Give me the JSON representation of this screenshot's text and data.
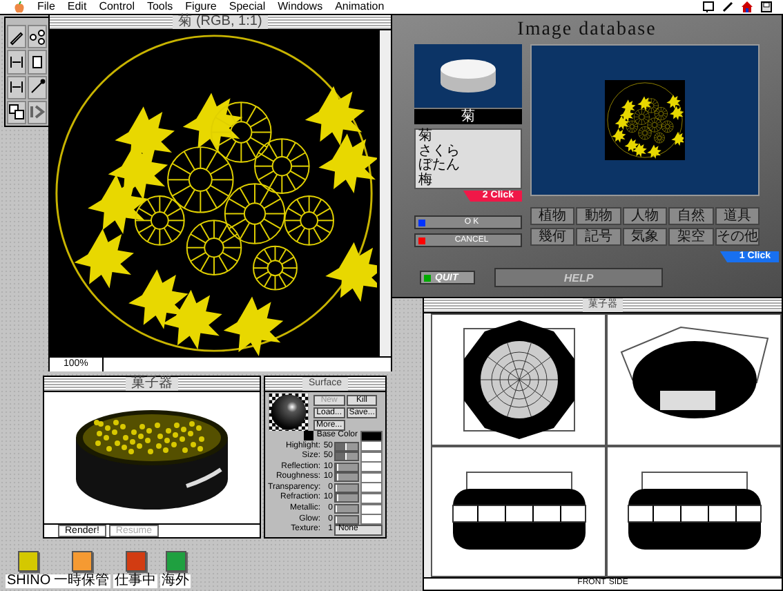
{
  "menu_bar": {
    "items": [
      "File",
      "Edit",
      "Control",
      "Tools",
      "Figure",
      "Special",
      "Windows",
      "Animation"
    ]
  },
  "image_window": {
    "title": "菊 (RGB, 1:1)",
    "zoom": "100%"
  },
  "image_database": {
    "title": "Image database",
    "caption": "菊",
    "list": [
      {
        "label": "菊",
        "selected": false
      },
      {
        "label": "さくら",
        "selected": false
      },
      {
        "label": "ぼたん",
        "selected": false
      },
      {
        "label": "梅",
        "selected": false
      }
    ],
    "list_hint": "2 Click",
    "ok": "O K",
    "cancel": "CANCEL",
    "categories": [
      "植物",
      "動物",
      "人物",
      "自然",
      "道具",
      "幾何",
      "記号",
      "気象",
      "架空",
      "その他"
    ],
    "grid_hint": "1 Click",
    "quit": "QUIT",
    "help": "HELP"
  },
  "render_window": {
    "title": "菓子器",
    "buttons": [
      {
        "label": "Render!",
        "disabled": false
      },
      {
        "label": "Resume",
        "disabled": true
      }
    ]
  },
  "surface_panel": {
    "title": "Surface",
    "buttons": [
      {
        "label": "New",
        "disabled": true
      },
      {
        "label": "Kill",
        "disabled": false
      },
      {
        "label": "Load...",
        "disabled": false
      },
      {
        "label": "Save...",
        "disabled": false
      },
      {
        "label": "More...",
        "disabled": false
      }
    ],
    "base_color": {
      "label": "Base Color",
      "checked": true
    },
    "sliders": [
      {
        "label": "Highlight:",
        "value": "50",
        "level": 0.5
      },
      {
        "label": "Size:",
        "value": "50",
        "level": 0.5
      },
      {
        "label": "Reflection:",
        "value": "10",
        "level": 0.1
      },
      {
        "label": "Roughness:",
        "value": "10",
        "level": 0.1
      },
      {
        "label": "Transparency:",
        "value": "0",
        "level": 0
      },
      {
        "label": "Refraction:",
        "value": "10",
        "level": 0.1
      },
      {
        "label": "Metallic:",
        "value": "0",
        "level": 0
      },
      {
        "label": "Glow:",
        "value": "0",
        "level": 0
      }
    ],
    "texture": {
      "label": "Texture:",
      "number": "1",
      "value": "None"
    }
  },
  "views_window": {
    "title": "菓子器",
    "front_label": "FRONT",
    "side_label": "SIDE"
  },
  "desktop_labels": [
    {
      "name": "SHINO",
      "color": "#d4c800"
    },
    {
      "name": "一時保管",
      "color": "#f59a32"
    },
    {
      "name": "仕事中",
      "color": "#d23c12"
    },
    {
      "name": "海外",
      "color": "#1fa040"
    }
  ]
}
